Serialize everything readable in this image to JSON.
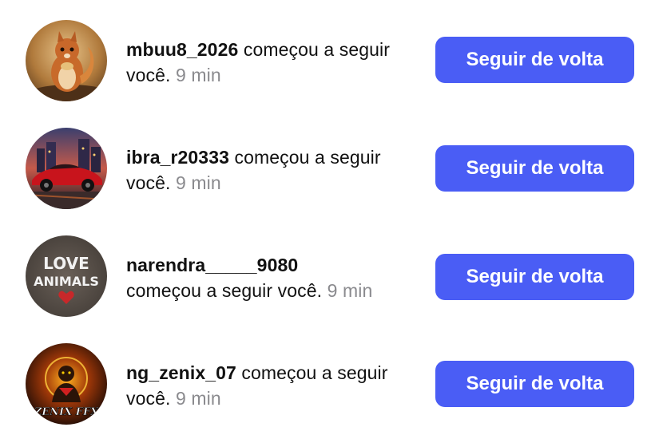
{
  "notifications": [
    {
      "username": "mbuu8_2026",
      "action": "começou a seguir você.",
      "time": "9 min",
      "button_label": "Seguir de volta",
      "avatar_icon": "squirrel-avatar-icon"
    },
    {
      "username": "ibra_r20333",
      "action": "começou a seguir você.",
      "time": "9 min",
      "button_label": "Seguir de volta",
      "avatar_icon": "red-car-avatar-icon"
    },
    {
      "username": "narendra_____9080",
      "action": "começou a seguir você.",
      "time": "9 min",
      "button_label": "Seguir de volta",
      "avatar_icon": "love-animals-avatar-icon",
      "avatar_text": [
        "LOVE",
        "ANIMALS"
      ]
    },
    {
      "username": "ng_zenix_07",
      "action": "começou a seguir você.",
      "time": "9 min",
      "button_label": "Seguir de volta",
      "avatar_icon": "zenix-ffx-avatar-icon",
      "avatar_text": [
        "ZENIX FFX"
      ]
    }
  ],
  "colors": {
    "button_bg": "#4a5df5",
    "button_text": "#ffffff",
    "time_text": "#8a8a8e"
  }
}
